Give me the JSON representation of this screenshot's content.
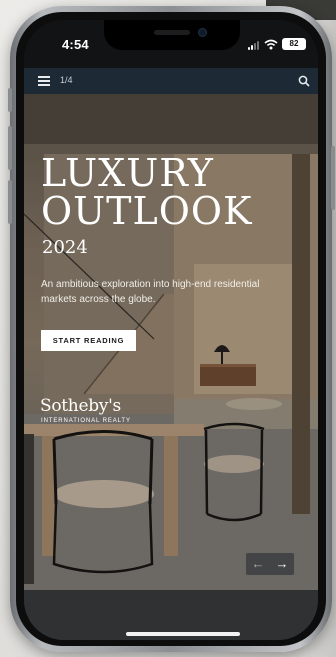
{
  "status_bar": {
    "time": "4:54",
    "battery_level": "82",
    "icons": [
      "signal-icon",
      "wifi-icon",
      "battery-icon"
    ]
  },
  "header": {
    "page_indicator": "1/4",
    "icons": [
      "menu-icon",
      "search-icon"
    ]
  },
  "hero": {
    "title_line1": "LUXURY",
    "title_line2": "OUTLOOK",
    "year": "2024",
    "subtitle": "An ambitious exploration into high-end residential markets across the globe.",
    "cta_label": "START READING",
    "brand_name": "Sotheby's",
    "brand_sub": "INTERNATIONAL REALTY",
    "nav_prev": "←",
    "nav_next": "→"
  },
  "colors": {
    "header_bg": "#1d2a36",
    "bottom_bar": "#2f3133",
    "cta_bg": "#ffffff"
  }
}
